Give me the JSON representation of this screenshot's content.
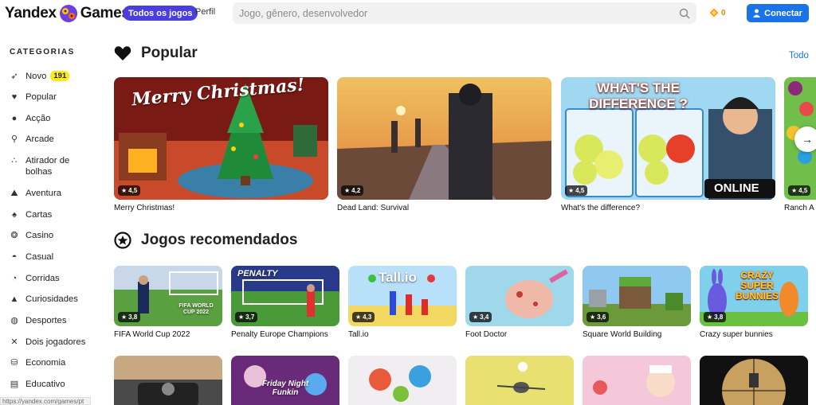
{
  "header": {
    "logo_left": "Yandex",
    "logo_right": "Games",
    "nav_all": "Todos os jogos",
    "nav_profile": "Perfil",
    "search_placeholder": "Jogo, gênero, desenvolvedor",
    "coins": "0",
    "connect": "Conectar"
  },
  "sidebar": {
    "title": "CATEGORIAS",
    "items": [
      {
        "label": "Novo",
        "icon": "rocket-icon",
        "badge": "191"
      },
      {
        "label": "Popular",
        "icon": "heart-icon"
      },
      {
        "label": "Acção",
        "icon": "bomb-icon"
      },
      {
        "label": "Arcade",
        "icon": "runner-icon"
      },
      {
        "label": "Atirador de bolhas",
        "icon": "bubbles-icon"
      },
      {
        "label": "Aventura",
        "icon": "backpack-icon"
      },
      {
        "label": "Cartas",
        "icon": "spade-icon"
      },
      {
        "label": "Casino",
        "icon": "chip-icon"
      },
      {
        "label": "Casual",
        "icon": "android-icon"
      },
      {
        "label": "Corridas",
        "icon": "speedometer-icon"
      },
      {
        "label": "Curiosidades",
        "icon": "graduation-icon"
      },
      {
        "label": "Desportes",
        "icon": "ball-icon"
      },
      {
        "label": "Dois jogadores",
        "icon": "crossed-swords-icon"
      },
      {
        "label": "Economia",
        "icon": "coins-icon"
      },
      {
        "label": "Educativo",
        "icon": "book-icon"
      }
    ],
    "status_url": "https://yandex.com/games/pt"
  },
  "popular": {
    "title": "Popular",
    "see_all": "Todo",
    "cards": [
      {
        "name": "Merry Christmas!",
        "rating": "4,5",
        "art": "Merry Christmas!"
      },
      {
        "name": "Dead Land: Survival",
        "rating": "4,2"
      },
      {
        "name": "What's the difference?",
        "rating": "4,5",
        "art": "WHAT'S THE DIFFERENCE ?",
        "art2": "ONLINE"
      },
      {
        "name": "Ranch A",
        "rating": "4,5"
      }
    ]
  },
  "recommended": {
    "title": "Jogos recomendados",
    "cards": [
      {
        "name": "FIFA World Cup 2022",
        "rating": "3,8",
        "art": "FIFA WORLD CUP 2022"
      },
      {
        "name": "Penalty Europe Champions",
        "rating": "3,7",
        "art": "PENALTY"
      },
      {
        "name": "Tall.io",
        "rating": "4,3",
        "art": "Tall.io"
      },
      {
        "name": "Foot Doctor",
        "rating": "3,4"
      },
      {
        "name": "Square World Building",
        "rating": "3,6"
      },
      {
        "name": "Crazy super bunnies",
        "rating": "3,8",
        "art": "CRAZY SUPER BUNNIES"
      }
    ],
    "row2_arts": [
      "",
      "Friday Night Funkin",
      "",
      "",
      "",
      ""
    ]
  },
  "colors": {
    "accent": "#4c3de0",
    "primary_button": "#1a73e8",
    "badge": "#ffe81a",
    "coin": "#e58a00"
  }
}
